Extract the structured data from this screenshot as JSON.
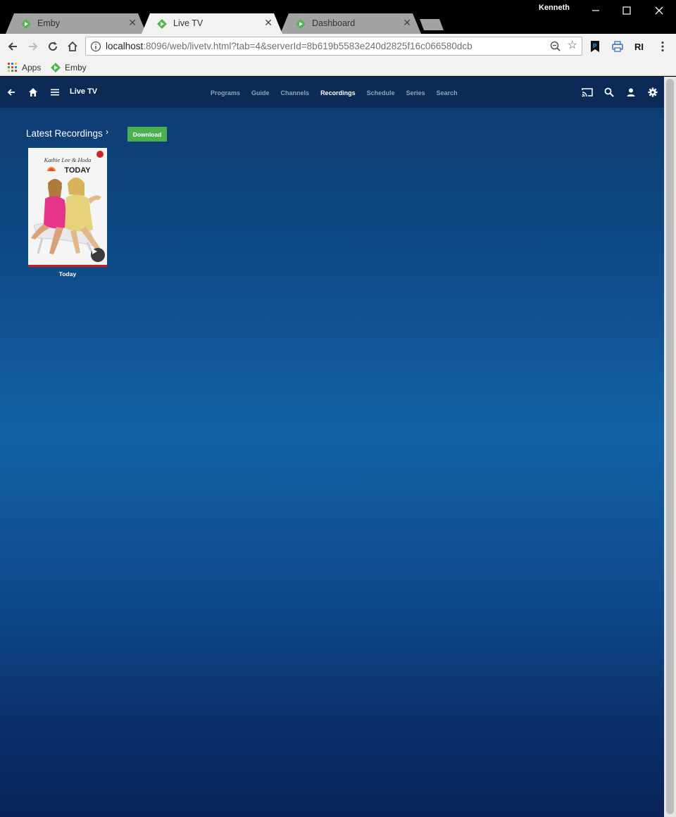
{
  "browser": {
    "tabs": [
      {
        "label": "Emby",
        "close": "✕"
      },
      {
        "label": "Live TV",
        "close": "✕"
      },
      {
        "label": "Dashboard",
        "close": "✕"
      }
    ],
    "profile_name": "Kenneth",
    "url_host": "localhost",
    "url_rest": ":8096/web/livetv.html?tab=4&serverId=8b619b5583e240d2825f16c066580dcb",
    "bookmarks": [
      {
        "label": "Apps",
        "icon": "apps-grid-icon"
      },
      {
        "label": "Emby",
        "icon": "emby-icon"
      }
    ]
  },
  "emby": {
    "header_title": "Live TV",
    "tabs": [
      "Programs",
      "Guide",
      "Channels",
      "Recordings",
      "Schedule",
      "Series",
      "Search"
    ],
    "active_tab": "Recordings",
    "section_title": "Latest Recordings",
    "section_chevron": "›",
    "download_label": "Download",
    "recordings": [
      {
        "title": "Today",
        "poster_line1": "Kathie Lee & Hoda",
        "poster_line2": "TODAY",
        "recording": true,
        "progress": 1.0
      }
    ]
  },
  "colors": {
    "accent_green": "#4caf50",
    "emby_green": "#52b54b",
    "header_bg": "#0b2a55",
    "record_red": "#d4202a"
  }
}
